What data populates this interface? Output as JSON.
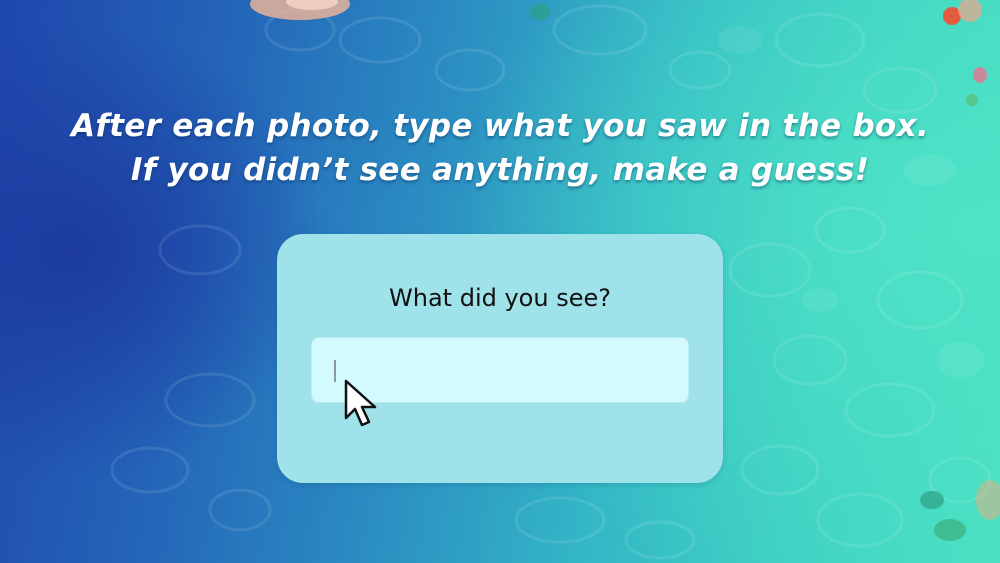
{
  "instructions": {
    "line1": "After each photo, type what you saw in the box.",
    "line2": "If you didn’t see anything, make a guess!"
  },
  "prompt": {
    "question": "What did you see?"
  },
  "answer_input": {
    "value": "",
    "placeholder": ""
  },
  "icons": {
    "pointer": "mouse-pointer-icon"
  },
  "colors": {
    "panel": "#9fe2ea",
    "input": "#d3fbff",
    "text_light": "#ffffff",
    "text_dark": "#111111"
  }
}
